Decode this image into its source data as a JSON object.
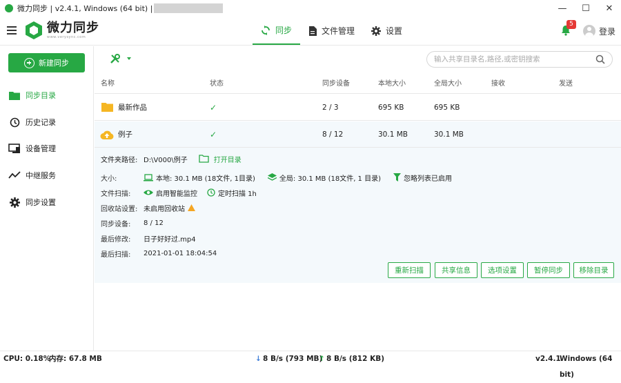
{
  "window": {
    "title": "微力同步 | v2.4.1, Windows (64 bit) |",
    "minimize": "—",
    "maximize": "☐",
    "close": "✕"
  },
  "header": {
    "logo_text": "微力同步",
    "logo_sub": "www.verysync.com",
    "tabs": [
      {
        "label": "同步",
        "icon": "sync-icon",
        "active": true
      },
      {
        "label": "文件管理",
        "icon": "file-icon"
      },
      {
        "label": "设置",
        "icon": "gear-icon"
      }
    ],
    "notification_count": "5",
    "login_label": "登录"
  },
  "sidebar": {
    "new_button": "新建同步",
    "items": [
      {
        "label": "同步目录",
        "icon": "folder-icon",
        "active": true
      },
      {
        "label": "历史记录",
        "icon": "history-icon"
      },
      {
        "label": "设备管理",
        "icon": "device-icon"
      },
      {
        "label": "中继服务",
        "icon": "relay-icon"
      },
      {
        "label": "同步设置",
        "icon": "gear-icon"
      }
    ]
  },
  "search": {
    "placeholder": "输入共享目录名,路径,或密钥搜索"
  },
  "table": {
    "headers": [
      "名称",
      "状态",
      "同步设备",
      "本地大小",
      "全局大小",
      "接收",
      "发送"
    ],
    "rows": [
      {
        "name": "最新作品",
        "status": "✓",
        "devices": "2 / 3",
        "local": "695 KB",
        "global": "695 KB",
        "recv": "",
        "send": ""
      },
      {
        "name": "例子",
        "status": "✓",
        "devices": "8 / 12",
        "local": "30.1 MB",
        "global": "30.1 MB",
        "recv": "",
        "send": ""
      }
    ]
  },
  "detail": {
    "path_label": "文件夹路径:",
    "path_value": "D:\\V000\\例子",
    "open_dir": "打开目录",
    "size_label": "大小:",
    "local_size": "本地: 30.1 MB (18文件, 1目录)",
    "global_size": "全局: 30.1 MB (18文件, 1 目录)",
    "ignore_list": "忽略列表已启用",
    "scan_label": "文件扫描:",
    "smart_monitor": "启用智能监控",
    "timed_scan": "定时扫描 1h",
    "recycle_label": "回收站设置:",
    "recycle_value": "未启用回收站",
    "devices_label": "同步设备:",
    "devices_value": "8 / 12",
    "modified_label": "最后修改:",
    "modified_value": "日子好好过.mp4",
    "scanned_label": "最后扫描:",
    "scanned_value": "2021-01-01 18:04:54",
    "actions": [
      "重新扫描",
      "共享信息",
      "选项设置",
      "暂停同步",
      "移除目录"
    ]
  },
  "status": {
    "cpu": "CPU: 0.18%",
    "mem": "内存: 67.8 MB",
    "down": "8 B/s (793 MB)",
    "up": "8 B/s (812 KB)",
    "version": "v2.4.1",
    "os": "Windows (64 bit)"
  },
  "colors": {
    "accent": "#27a844",
    "selected_bg": "#f4f9fc",
    "folder": "#f5b623",
    "warning": "#f5a623",
    "down_arrow": "#3d7dd8"
  }
}
